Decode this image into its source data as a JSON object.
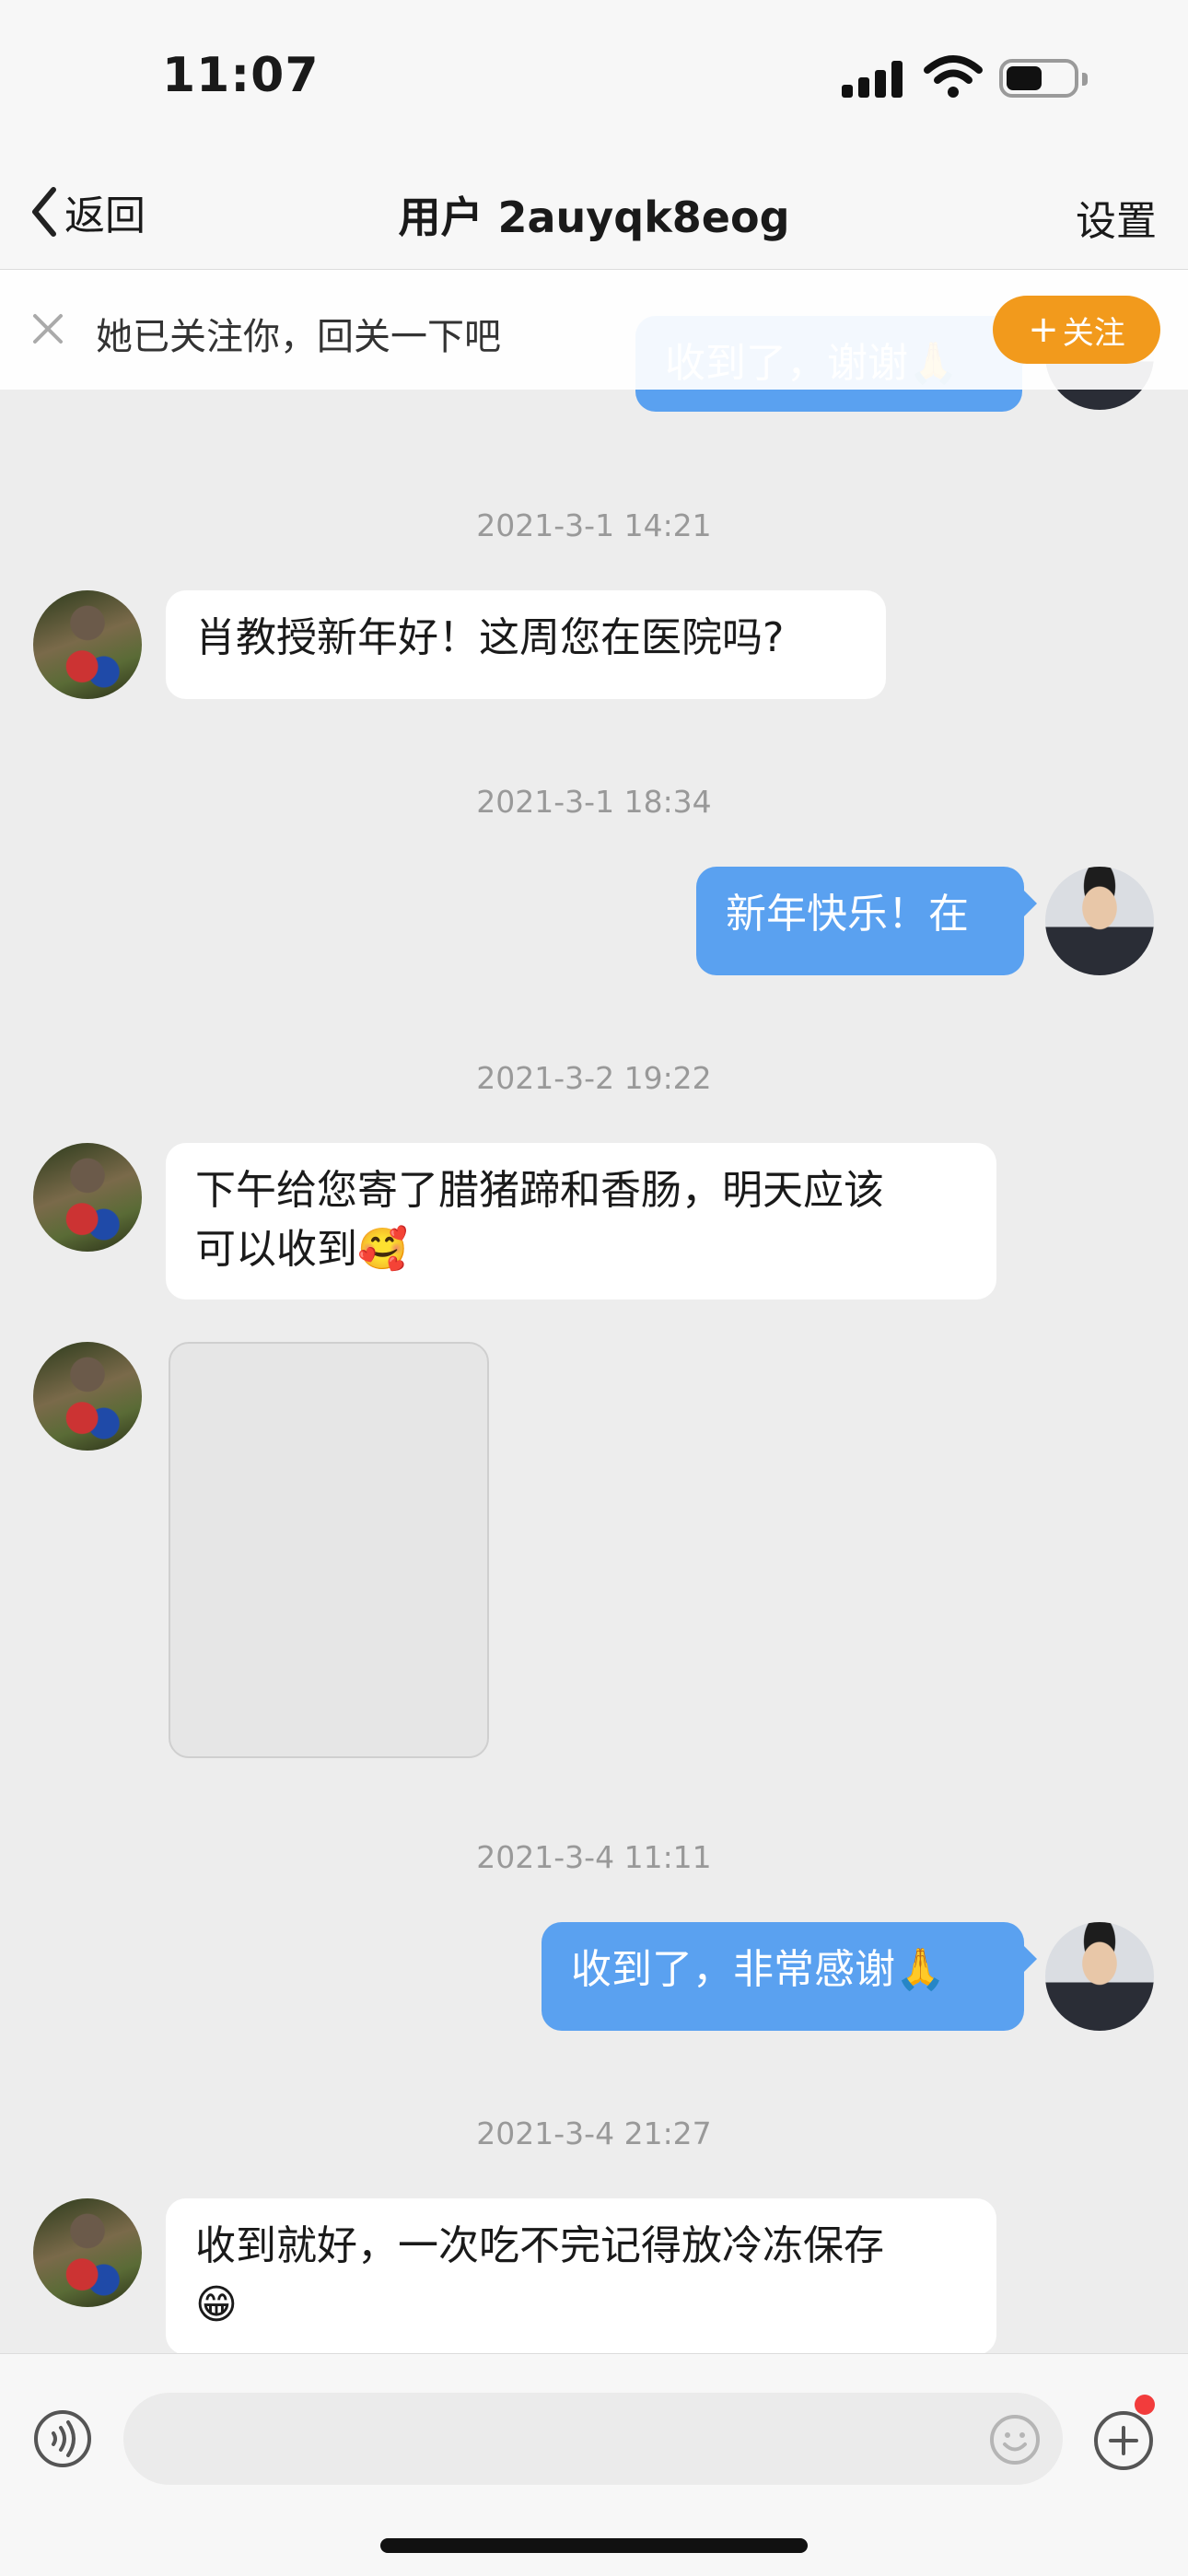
{
  "status_bar": {
    "time": "11:07"
  },
  "nav": {
    "back_label": "返回",
    "title": "用户 2auyqk8eog",
    "settings_label": "设置"
  },
  "banner": {
    "text": "她已关注你，回关一下吧",
    "follow_label": "关注",
    "follow_plus": "+",
    "peeking_message": "收到了，谢谢🙏"
  },
  "messages": [
    {
      "timestamp": "2021-3-1 14:21",
      "side": "in",
      "text": "肖教授新年好！这周您在医院吗?"
    },
    {
      "timestamp": "2021-3-1 18:34",
      "side": "out",
      "text": "新年快乐！在"
    },
    {
      "timestamp": "2021-3-2 19:22",
      "side": "in",
      "text_line1": "下午给您寄了腊猪蹄和香肠，明天应该",
      "text_line2": "可以收到🥰"
    },
    {
      "side": "in",
      "type": "image"
    },
    {
      "timestamp": "2021-3-4 11:11",
      "side": "out",
      "text": "收到了，非常感谢🙏"
    },
    {
      "timestamp": "2021-3-4 21:27",
      "side": "in",
      "text_line1": "收到就好，一次吃不完记得放冷冻保存",
      "text_line2": "😁"
    }
  ],
  "input": {
    "placeholder": ""
  },
  "icons": {
    "voice": "voice-icon",
    "emoji": "emoji-icon",
    "plus": "plus-icon",
    "close": "close-icon",
    "back": "chevron-left-icon"
  },
  "colors": {
    "outgoing_bubble": "#5aa1f0",
    "incoming_bubble": "#ffffff",
    "follow_button": "#f29a1c",
    "background": "#ededed"
  }
}
